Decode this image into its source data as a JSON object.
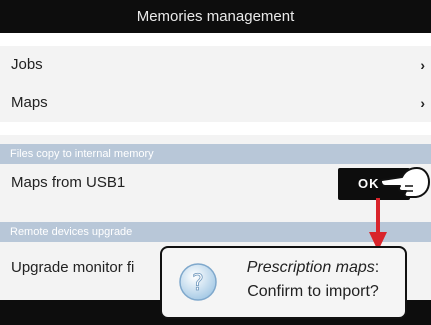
{
  "header": {
    "title": "Memories management"
  },
  "menu": {
    "items": [
      {
        "label": "Jobs",
        "chevron": "›"
      },
      {
        "label": "Maps",
        "chevron": "›"
      }
    ]
  },
  "sections": [
    {
      "header": "Files copy to internal memory",
      "row_label": "Maps from USB1"
    },
    {
      "header": "Remote devices upgrade",
      "row_label": "Upgrade monitor fi"
    }
  ],
  "ok_button": {
    "label": "OK"
  },
  "dialog": {
    "title": "Prescription maps",
    "title_suffix": ":",
    "message": "Confirm to import?"
  },
  "colors": {
    "title_bar": "#0d0d0d",
    "section_header": "#b8c7d8",
    "arrow": "#d9242b"
  },
  "icons": [
    "chevron-right-icon",
    "pointing-hand-icon",
    "red-down-arrow-icon",
    "question-mark-icon"
  ]
}
